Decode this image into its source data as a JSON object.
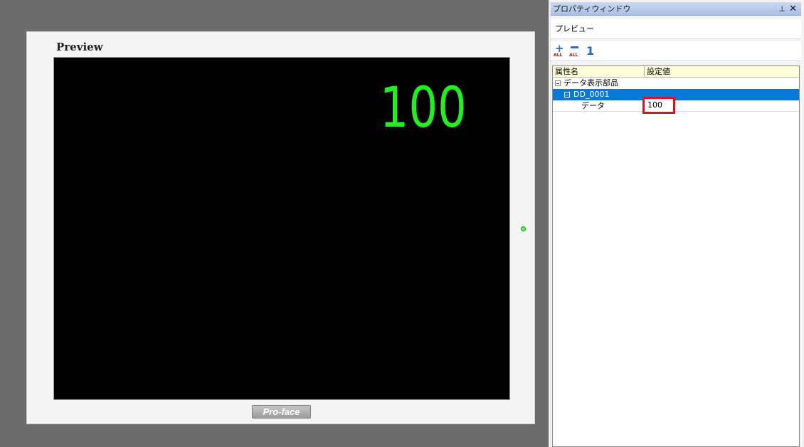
{
  "preview": {
    "title": "Preview",
    "display_value": "100",
    "logo": "Pro-face",
    "display_color": "#22ee22"
  },
  "panel": {
    "title": "プロパティウィンドウ",
    "pin_glyph": "ᵖ",
    "close_glyph": "✕",
    "preview_label": "プレビュー",
    "toolbar": {
      "expand_all_icon": "plus-all-icon",
      "expand_all_text": "ALL",
      "collapse_all_icon": "minus-all-icon",
      "collapse_all_text": "ALL",
      "number_label": "1"
    },
    "grid": {
      "col_name": "属性名",
      "col_value": "設定値",
      "rows": [
        {
          "label": "データ表示部品",
          "value": ""
        },
        {
          "label": "DD_0001",
          "value": ""
        },
        {
          "label": "データ",
          "value": "100"
        }
      ]
    },
    "selection_color": "#0a78d7",
    "highlight_color": "#e01020"
  }
}
